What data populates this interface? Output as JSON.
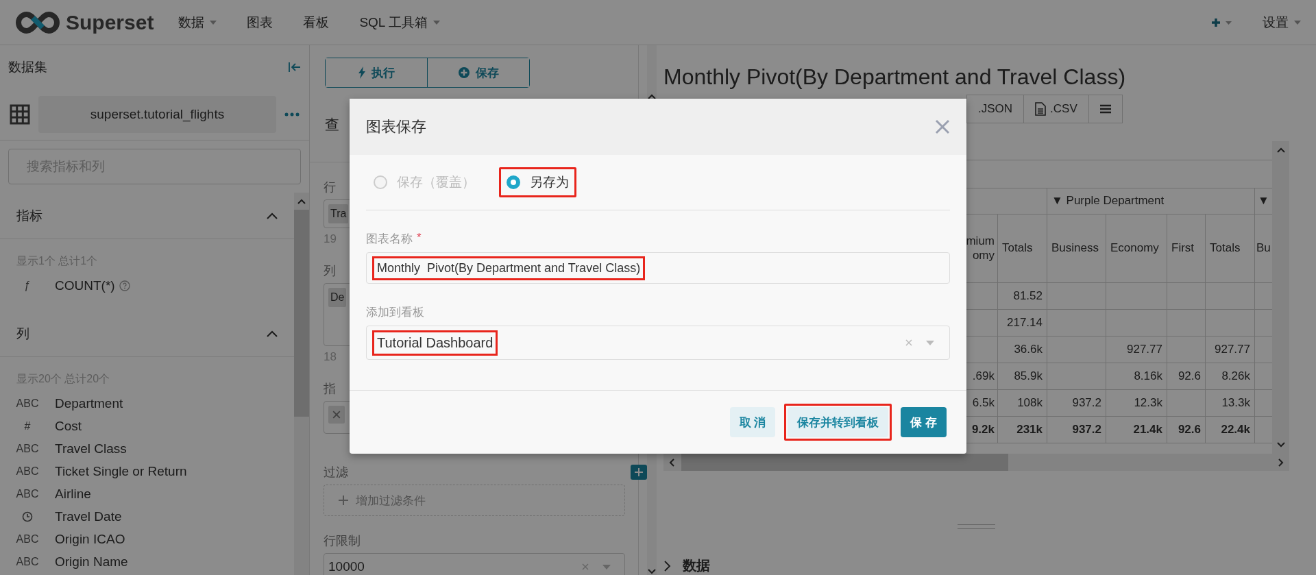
{
  "navbar": {
    "brand": "Superset",
    "menu": [
      {
        "label": "数据",
        "dropdown": true
      },
      {
        "label": "图表",
        "dropdown": false
      },
      {
        "label": "看板",
        "dropdown": false
      },
      {
        "label": "SQL 工具箱",
        "dropdown": true
      }
    ],
    "settings": {
      "label": "设置",
      "dropdown": true
    }
  },
  "dataset_panel": {
    "title": "数据集",
    "dataset": "superset.tutorial_flights",
    "search": {
      "placeholder": "搜索指标和列"
    },
    "sections": [
      {
        "title": "指标",
        "expanded": true,
        "summary": "显示1个 总计1个",
        "items": [
          {
            "kind": "text",
            "badge": "ƒ",
            "name": "COUNT(*)",
            "info": true
          }
        ]
      },
      {
        "title": "列",
        "expanded": true,
        "summary": "显示20个 总计20个",
        "items": [
          {
            "kind": "text",
            "badge": "ABC",
            "name": "Department",
            "info": false
          },
          {
            "kind": "text",
            "badge": "#",
            "name": "Cost",
            "info": false
          },
          {
            "kind": "text",
            "badge": "ABC",
            "name": "Travel Class",
            "info": false
          },
          {
            "kind": "text",
            "badge": "ABC",
            "name": "Ticket Single or Return",
            "info": false
          },
          {
            "kind": "text",
            "badge": "ABC",
            "name": "Airline",
            "info": false
          },
          {
            "kind": "time",
            "name": "Travel Date",
            "info": false
          },
          {
            "kind": "text",
            "badge": "ABC",
            "name": "Origin ICAO",
            "info": false
          },
          {
            "kind": "text",
            "badge": "ABC",
            "name": "Origin Name",
            "info": false
          }
        ]
      }
    ]
  },
  "query_panel": {
    "buttons": [
      {
        "kind": "run",
        "label": "执行"
      },
      {
        "kind": "save",
        "label": "保存"
      }
    ],
    "section_title": "查",
    "rows": {
      "label": "行",
      "chip": "Tra",
      "hint": "19"
    },
    "columns": {
      "label": "列",
      "chip": "De",
      "hint": "18"
    },
    "metrics": {
      "label": "指"
    },
    "filters": {
      "label": "过滤",
      "placeholder": "增加过滤条件"
    },
    "row_limit": {
      "label": "行限制",
      "value": "10000"
    }
  },
  "chart": {
    "title": "Monthly Pivot(By Department and Travel Class)",
    "actions": [
      {
        "kind": "json",
        "label": ".JSON"
      },
      {
        "kind": "csv",
        "label": ".CSV"
      },
      {
        "kind": "menu"
      }
    ],
    "table": {
      "group_headers": [
        "▼ Purple Department",
        "▼"
      ],
      "columns": [
        "mium\nomy",
        "Totals",
        "Business",
        "Economy",
        "First",
        "Totals",
        "Bu"
      ],
      "rows": [
        {
          "total": false,
          "cells": [
            null,
            "81.52",
            null,
            null,
            null,
            null,
            null
          ]
        },
        {
          "total": false,
          "cells": [
            null,
            "217.14",
            null,
            null,
            null,
            null,
            null
          ]
        },
        {
          "total": false,
          "cells": [
            null,
            "36.6k",
            null,
            "927.77",
            null,
            "927.77",
            null
          ]
        },
        {
          "total": false,
          "cells": [
            ".69k",
            "85.9k",
            null,
            "8.16k",
            "92.6",
            "8.26k",
            null
          ]
        },
        {
          "total": false,
          "cells": [
            "6.5k",
            "108k",
            "937.2",
            "12.3k",
            null,
            "13.3k",
            null
          ]
        },
        {
          "total": true,
          "cells": [
            "9.2k",
            "231k",
            "937.2",
            "21.4k",
            "92.6",
            "22.4k",
            null
          ]
        }
      ]
    }
  },
  "data_section": {
    "title": "数据",
    "expanded": false
  },
  "save_dialog": {
    "title": "图表保存",
    "options": [
      {
        "label": "保存（覆盖）",
        "selected": false,
        "disabled": true,
        "highlighted": false
      },
      {
        "label": "另存为",
        "selected": true,
        "disabled": false,
        "highlighted": true
      }
    ],
    "name_field": {
      "label": "图表名称",
      "required_mark": "*",
      "value": "Monthly  Pivot(By Department and Travel Class)",
      "highlighted": true
    },
    "dashboard_field": {
      "label": "添加到看板",
      "value": "Tutorial Dashboard",
      "highlighted": true
    },
    "buttons": [
      {
        "kind": "secondary",
        "label": "取 消",
        "highlighted": false
      },
      {
        "kind": "secondary",
        "label": "保存并转到看板",
        "highlighted": true
      },
      {
        "kind": "primary",
        "label": "保 存",
        "highlighted": false
      }
    ]
  }
}
